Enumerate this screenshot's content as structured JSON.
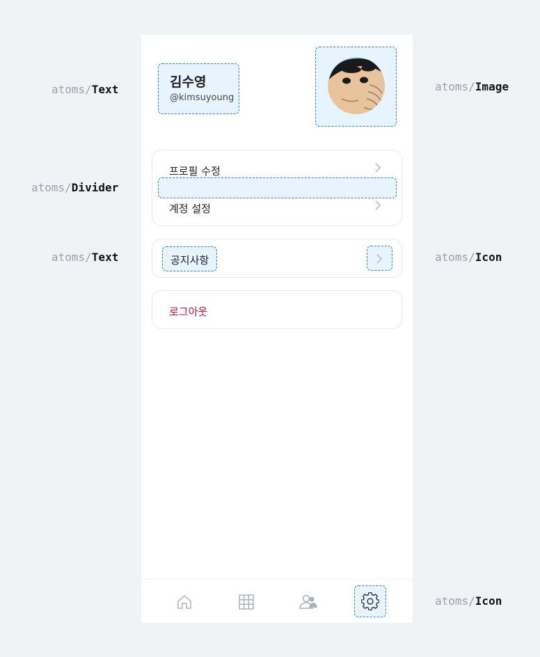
{
  "annotations": {
    "prefix": "atoms/",
    "text_top": "Text",
    "image": "Image",
    "divider": "Divider",
    "text_mid": "Text",
    "icon_mid": "Icon",
    "icon_bottom": "Icon"
  },
  "profile": {
    "name": "김수영",
    "handle": "@kimsuyoung",
    "avatar_icon": "avatar-cartoon-boy"
  },
  "menu": {
    "group1": [
      {
        "label": "프로필 수정",
        "icon": "chevron-right-icon"
      },
      {
        "label": "계정 설정",
        "icon": "chevron-right-icon"
      }
    ],
    "notice": {
      "label": "공지사항",
      "icon": "chevron-right-icon"
    },
    "logout": {
      "label": "로그아웃"
    }
  },
  "tabbar": [
    {
      "icon": "home-icon"
    },
    {
      "icon": "grid-icon"
    },
    {
      "icon": "users-icon"
    },
    {
      "icon": "gear-icon",
      "active": true
    }
  ],
  "colors": {
    "annotation_border": "#2f7fd6",
    "annotation_fill": "#e8f4fd",
    "logout_red": "#c8102e",
    "background": "#f0f3f6"
  }
}
